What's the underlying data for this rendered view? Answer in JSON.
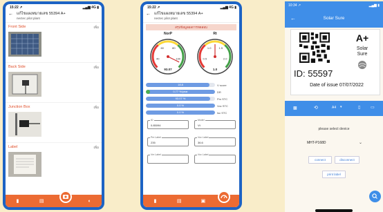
{
  "phone1": {
    "time": "15:22 ↗",
    "signal": "▂▄▆ 4G ▮",
    "title": "แก้ไขแผงหมายเลข 55394 A+",
    "subtitle": "nectec pilot plant",
    "edit_label": "เพิ่ม",
    "sections": [
      {
        "label": "Front Side"
      },
      {
        "label": "Back Side"
      },
      {
        "label": "Junction Box"
      },
      {
        "label": "Label"
      }
    ]
  },
  "phone2": {
    "time": "15:22 ↗",
    "signal": "▂▄▆ 4G ▮",
    "title": "แก้ไขแผงหมายเลข 55394 A+",
    "subtitle": "nectec pilot plant",
    "banner": "สรุปข้อมูลผลการทดสอบ",
    "gauges": [
      {
        "label": "NorP",
        "value": "93.07",
        "fraction": 0.93,
        "ticks": [
          "40",
          "60",
          "80",
          "100"
        ]
      },
      {
        "label": "Rt",
        "value": "1.0",
        "fraction": 0.5,
        "ticks": [
          "0.5",
          "1.0",
          "1.5",
          "2.0"
        ]
      }
    ],
    "bars": [
      {
        "text": "18.8",
        "label": "V score",
        "fraction": 0.92,
        "color": "#6e9be3"
      },
      {
        "text": "0.77 %/year",
        "label": "DR",
        "fraction": 1.0,
        "color": "#6e9be3",
        "dot": "#4caf50"
      },
      {
        "text": "93.07 %",
        "label": "Pm STC",
        "fraction": 0.93,
        "color": "#6e9be3"
      },
      {
        "text": "0.0 %",
        "label": "Voc STC",
        "fraction": 1.0,
        "color": "#6e9be3"
      },
      {
        "text": "0.0 %",
        "label": "Isc STC",
        "fraction": 1.0,
        "color": "#6e9be3"
      }
    ],
    "fields": [
      {
        "label": "ID",
        "value": "0.85094"
      },
      {
        "label": "Model",
        "value": "Vt"
      },
      {
        "label": "Pm Label",
        "value": "235"
      },
      {
        "label": "Voc Label",
        "value": "36.6"
      },
      {
        "label": "Vm Label",
        "value": ""
      },
      {
        "label": "Voc Label",
        "value": ""
      }
    ]
  },
  "phone3": {
    "time": "10:34 ↗",
    "signal": "▂▄▆ ▮",
    "title": "Solar Sure",
    "grade": "A+",
    "brand_line1": "Solar",
    "brand_line2": "Sure",
    "id_text": "ID: 55597",
    "issue_date": "Date of issue 07/07/2022",
    "toolbar": {
      "paper": "A4"
    },
    "select_prompt": "please select device",
    "device": "MHT-P168D",
    "connect": "connect",
    "disconnect": "disconnect",
    "print": "print label"
  },
  "colors": {
    "frame_blue": "#1d63c4",
    "accent_orange": "#ec6b33",
    "bg": "#f9edc9"
  }
}
